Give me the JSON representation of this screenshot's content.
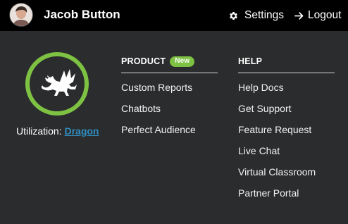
{
  "user": {
    "name": "Jacob Button",
    "avatar_icon": "user-avatar-photo"
  },
  "header": {
    "settings_label": "Settings",
    "settings_icon": "gear-icon",
    "logout_label": "Logout",
    "logout_icon": "logout-arrow-icon"
  },
  "plan": {
    "logo_icon": "dragon-icon",
    "ring_color": "#7dc242",
    "utilization_label": "Utilization:",
    "utilization_value": "Dragon",
    "link_color": "#2f8dbf"
  },
  "product": {
    "heading": "PRODUCT",
    "badge": "New",
    "items": [
      "Custom Reports",
      "Chatbots",
      "Perfect Audience"
    ]
  },
  "help": {
    "heading": "HELP",
    "items": [
      "Help Docs",
      "Get Support",
      "Feature Request",
      "Live Chat",
      "Virtual Classroom",
      "Partner Portal"
    ]
  },
  "colors": {
    "topbar": "#000000",
    "panel": "#2b2c2d",
    "accent": "#7dc242"
  }
}
